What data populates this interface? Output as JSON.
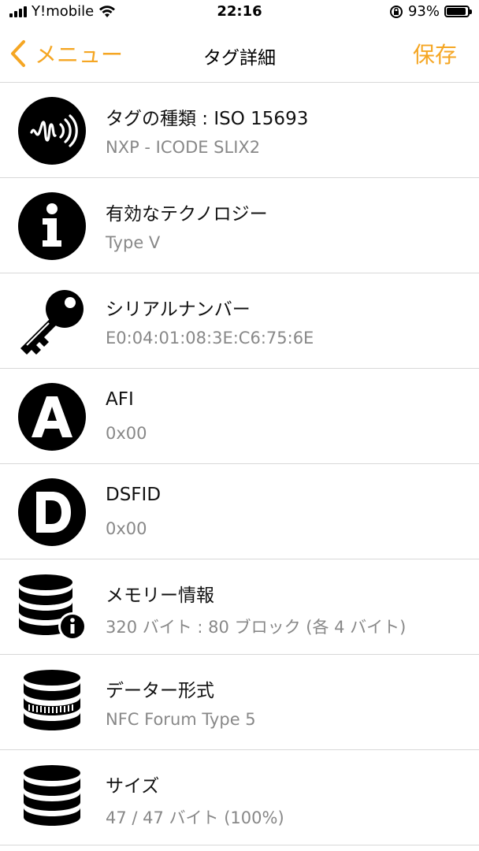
{
  "status": {
    "carrier": "Y!mobile",
    "time": "22:16",
    "battery_percent": "93%",
    "battery_level": 0.93,
    "icons": [
      "signal-icon",
      "wifi-icon",
      "orientation-lock-icon",
      "battery-icon"
    ]
  },
  "nav": {
    "back_label": "メニュー",
    "title": "タグ詳細",
    "save_label": "保存",
    "accent_color": "#f5a623"
  },
  "rows": [
    {
      "icon": "nfc-tag-icon",
      "title": "タグの種類 : ISO 15693",
      "value": "NXP - ICODE SLIX2"
    },
    {
      "icon": "info-icon",
      "title": "有効なテクノロジー",
      "value": "Type V"
    },
    {
      "icon": "key-icon",
      "title": "シリアルナンバー",
      "value": "E0:04:01:08:3E:C6:75:6E"
    },
    {
      "icon": "letter-a-icon",
      "title": "AFI",
      "value": "0x00"
    },
    {
      "icon": "letter-d-icon",
      "title": "DSFID",
      "value": "0x00"
    },
    {
      "icon": "database-info-icon",
      "title": "メモリー情報",
      "value": "320 バイト : 80 ブロック (各 4 バイト)"
    },
    {
      "icon": "database-format-icon",
      "title": "データー形式",
      "value": "NFC Forum Type 5"
    },
    {
      "icon": "database-icon",
      "title": "サイズ",
      "value": "47 / 47 バイト (100%)"
    }
  ]
}
